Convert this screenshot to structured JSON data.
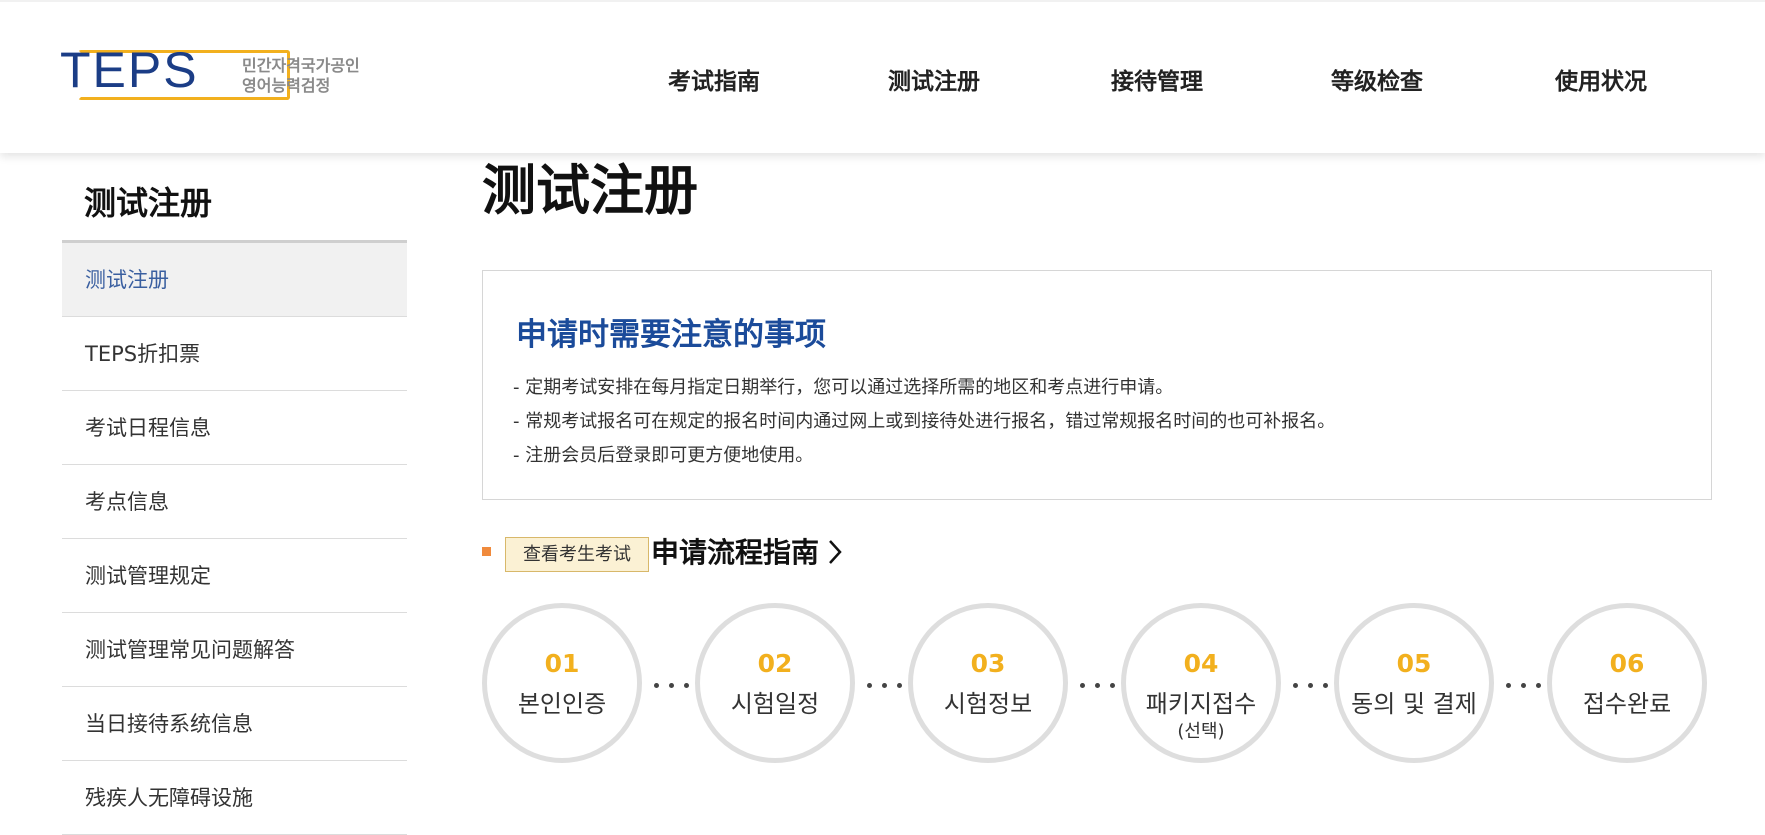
{
  "header": {
    "logo_text": "TEPS",
    "logo_sub_line1": "민간자격국가공인",
    "logo_sub_line2": "영어능력검정",
    "nav": [
      "考试指南",
      "测试注册",
      "接待管理",
      "等级检查",
      "使用状况"
    ]
  },
  "sidebar": {
    "title": "测试注册",
    "items": [
      {
        "label": "测试注册",
        "active": true
      },
      {
        "label": "TEPS折扣票"
      },
      {
        "label": "考试日程信息"
      },
      {
        "label": "考点信息"
      },
      {
        "label": "测试管理规定"
      },
      {
        "label": "测试管理常见问题解答"
      },
      {
        "label": "当日接待系统信息"
      },
      {
        "label": "残疾人无障碍设施"
      }
    ]
  },
  "main": {
    "title": "测试注册",
    "notice": {
      "title": "申请时需要注意的事项",
      "lines": [
        "- 定期考试安排在每月指定日期举行，您可以通过选择所需的地区和考点进行申请。",
        "- 常规考试报名可在规定的报名时间内通过网上或到接待处进行报名，错过常规报名时间的也可补报名。",
        "- 注册会员后登录即可更方便地使用。"
      ]
    },
    "check_button": "查看考生考试",
    "section_title": "申请流程指南",
    "steps": [
      {
        "num": "01",
        "label": "본인인증"
      },
      {
        "num": "02",
        "label": "시험일정"
      },
      {
        "num": "03",
        "label": "시험정보"
      },
      {
        "num": "04",
        "label": "패키지접수",
        "sub": "(선택)"
      },
      {
        "num": "05",
        "label": "동의 및 결제"
      },
      {
        "num": "06",
        "label": "접수완료"
      }
    ]
  },
  "colors": {
    "brand_blue": "#1b3d86",
    "accent_yellow": "#f2b01e",
    "notice_title_blue": "#1b4b9a",
    "bullet_orange": "#f08a3c"
  }
}
